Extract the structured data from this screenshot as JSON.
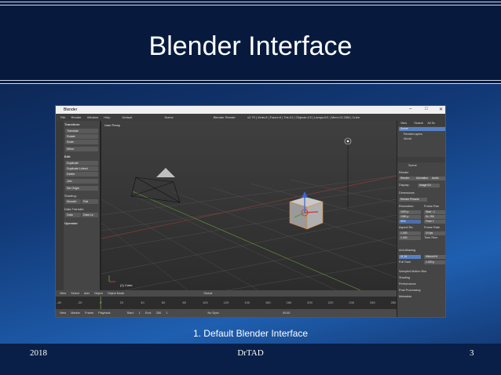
{
  "slide": {
    "title": "Blender Interface",
    "caption": "1. Default Blender Interface",
    "year": "2018",
    "author": "DrTAD",
    "page": "3"
  },
  "blender": {
    "window_title": "Blender",
    "window_buttons": [
      "–",
      "□",
      "✕"
    ],
    "info_menu": [
      "File",
      "Render",
      "Window",
      "Help",
      "Default",
      "Scene",
      "Blender Render",
      "v2.79 | Verts:8 | Faces:6 | Tris:12 | Objects:1/3 | Lamps:0/1 | Mem:13.33M | Cube"
    ],
    "tools": {
      "transform": "Transform",
      "translate": "Translate",
      "rotate": "Rotate",
      "scale": "Scale",
      "mirror": "Mirror",
      "edit": "Edit",
      "duplicate": "Duplicate",
      "duplicate_linked": "Duplicate Linked",
      "delete": "Delete",
      "join": "Join",
      "set_origin": "Set Origin",
      "shading": "Shading:",
      "smooth": "Smooth",
      "flat": "Flat",
      "data_transfer": "Data Transfer:",
      "data": "Data",
      "data_la": "Data La",
      "operator": "Operator"
    },
    "viewport": {
      "label": "User Persp",
      "object": "(1) Cube"
    },
    "view_header": [
      "View",
      "Select",
      "Add",
      "Object",
      "Object Mode",
      "Global"
    ],
    "timeline_ticks": [
      "-40",
      "-20",
      "0",
      "20",
      "40",
      "60",
      "80",
      "100",
      "120",
      "140",
      "160",
      "180",
      "200",
      "220",
      "240",
      "260",
      "280"
    ],
    "timeline_header": [
      "View",
      "Marker",
      "Frame",
      "Playback",
      "Start:",
      "1",
      "End:",
      "250",
      "1",
      "No Sync",
      "00:00"
    ],
    "outliner": {
      "tabs": [
        "View",
        "Search",
        "All Sc"
      ],
      "items": [
        "Scene",
        "RenderLayers",
        "World"
      ]
    },
    "properties": {
      "scene": "Scene",
      "render": "Render",
      "render_buttons": [
        "Render",
        "Animation",
        "Audio"
      ],
      "display": "Display:",
      "display_val": "Image Ed",
      "dimensions": "Dimensions",
      "presets": "Render Presets",
      "resolution": "Resolution:",
      "frame_range": "Frame Ran",
      "res_x": "1920 p",
      "res_y": "1080 p",
      "res_pct": "50%",
      "start": "Start : 1",
      "end": "En 250",
      "step": "Fram 1",
      "aspect": "Aspect Ra",
      "frame_rate": "Frame Rate",
      "aspect_x": "1.000",
      "aspect_y": "1.000",
      "fps": "24 fps",
      "time_rem": "Time Rem",
      "anti_aliasing": "Anti-Aliasing",
      "aa_samples": "11 16",
      "aa_filter": "Mitchell-N",
      "full_sample": "Full Sam",
      "full_sample_val": "1.000 p",
      "motion_blur": "Sampled Motion Blur",
      "shading": "Shading",
      "performance": "Performance",
      "post": "Post Processing",
      "metadata": "Metadata"
    }
  }
}
